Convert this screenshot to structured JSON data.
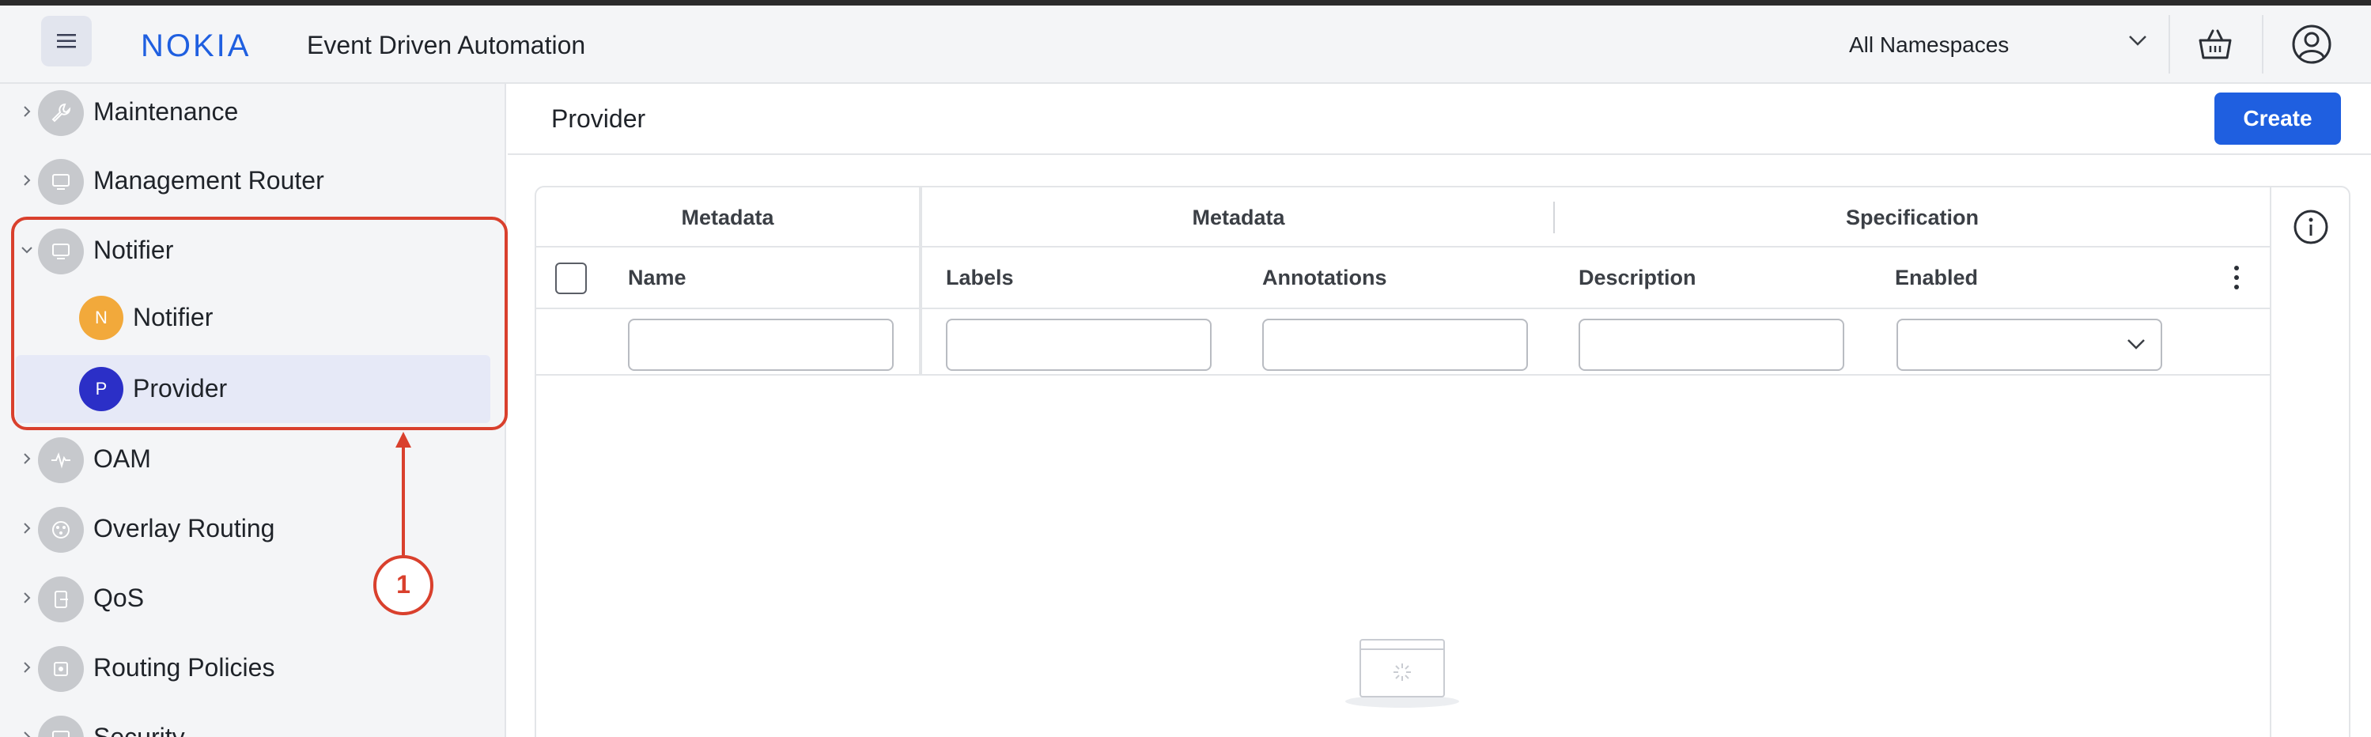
{
  "header": {
    "menu_icon": "hamburger-icon",
    "logo_text": "NOKIA",
    "app_title": "Event Driven Automation",
    "namespace_select": "All Namespaces",
    "basket_icon": "basket-icon",
    "account_icon": "user-circle-icon"
  },
  "sidebar": {
    "items": [
      {
        "label": "Maintenance",
        "icon": "wrench-icon",
        "expanded": false
      },
      {
        "label": "Management Router",
        "icon": "monitor-icon",
        "expanded": false
      },
      {
        "label": "Notifier",
        "icon": "monitor-icon",
        "expanded": true,
        "children": [
          {
            "label": "Notifier",
            "avatar": "N",
            "color": "#f2a93b"
          },
          {
            "label": "Provider",
            "avatar": "P",
            "color": "#2b2fc7",
            "selected": true
          }
        ]
      },
      {
        "label": "OAM",
        "icon": "pulse-icon",
        "expanded": false
      },
      {
        "label": "Overlay Routing",
        "icon": "network-icon",
        "expanded": false
      },
      {
        "label": "QoS",
        "icon": "qos-icon",
        "expanded": false
      },
      {
        "label": "Routing Policies",
        "icon": "policy-icon",
        "expanded": false
      },
      {
        "label": "Security",
        "icon": "monitor-icon",
        "expanded": false
      }
    ]
  },
  "annotation": {
    "number": "1",
    "color": "#d9402d"
  },
  "main": {
    "title": "Provider",
    "create_label": "Create",
    "table": {
      "groups": [
        "Metadata",
        "Metadata",
        "Specification"
      ],
      "columns": [
        "Name",
        "Labels",
        "Annotations",
        "Description",
        "Enabled"
      ],
      "filters": {
        "name": "",
        "labels": "",
        "annotations": "",
        "description": "",
        "enabled": ""
      },
      "info_icon": "info-icon",
      "empty_icon": "empty-state-icon"
    }
  },
  "colors": {
    "accent": "#1f5fe0",
    "selected_bg": "#e6e9f7",
    "annotation": "#d9402d"
  }
}
